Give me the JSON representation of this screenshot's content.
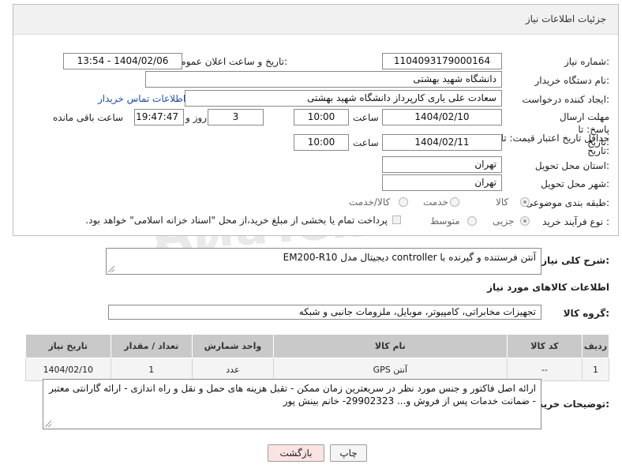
{
  "header": {
    "title": "جزئیات اطلاعات نیاز"
  },
  "watermark": {
    "text": "AriaTender.neT"
  },
  "form": {
    "need_number": {
      "label": "شماره نیاز:",
      "value": "1104093179000164"
    },
    "announce": {
      "label": "تاریخ و ساعت اعلان عمومی:",
      "value": "1404/02/06 - 13:54"
    },
    "buyer": {
      "label": "نام دستگاه خریدار:",
      "value": "دانشگاه شهید بهشتی"
    },
    "creator": {
      "label": "ایجاد کننده درخواست:",
      "value": "سعادت علی یاری کارپرداز دانشگاه شهید بهشتی",
      "contact_link": "اطلاعات تماس خریدار"
    },
    "response_deadline": {
      "label": "مهلت ارسال پاسخ: تا تاریخ:",
      "date": "1404/02/10",
      "time_label": "ساعت",
      "time": "10:00",
      "days": "3",
      "days_label": "روز و",
      "remaining": "19:47:47",
      "remaining_label": "ساعت باقی مانده"
    },
    "price_validity": {
      "label": "حداقل تاریخ اعتبار قیمت: تا تاریخ:",
      "date": "1404/02/11",
      "time_label": "ساعت",
      "time": "10:00"
    },
    "province": {
      "label": "استان محل تحویل:",
      "value": "تهران"
    },
    "city": {
      "label": "شهر محل تحویل:",
      "value": "تهران"
    },
    "category": {
      "label": "طبقه بندی موضوعی:",
      "options": [
        "کالا",
        "خدمت",
        "کالا/خدمت"
      ],
      "selected": "کالا"
    },
    "process": {
      "label": "نوع فرآیند خرید :",
      "options": [
        "جزیی",
        "متوسط"
      ],
      "selected": "جزیی",
      "note": "پرداخت تمام یا بخشی از مبلغ خرید،از محل \"اسناد خزانه اسلامی\" خواهد بود."
    }
  },
  "description": {
    "label": "شرح کلی نیاز:",
    "value": "آنتن فرستنده و گیرنده با controller دیجیتال مدل EM200-R10"
  },
  "goods_section": {
    "title": "اطلاعات کالاهای مورد نیاز"
  },
  "goods_group": {
    "label": "گروه کالا:",
    "value": "تجهیزات مخابراتی، کامپیوتر، موبایل، ملزومات جانبی و شبکه"
  },
  "table": {
    "headers": [
      "ردیف",
      "کد کالا",
      "نام کالا",
      "واحد شمارش",
      "تعداد / مقدار",
      "تاریخ نیاز"
    ],
    "rows": [
      [
        "1",
        "--",
        "آنتن GPS",
        "عدد",
        "1",
        "1404/02/10"
      ]
    ]
  },
  "buyer_notes": {
    "label": "توضیحات خریدار:",
    "value": "ارائه اصل فاکتور و جنس مورد نظر در سریعترین زمان ممکن - تقبل هزینه های حمل و نقل و راه اندازی - ارائه گارانتی معتبر - ضمانت خدمات پس از فروش و... 29902323- خانم بینش پور"
  },
  "buttons": {
    "print": "چاپ",
    "back": "بازگشت"
  },
  "colors": {
    "back_button_bg": "#fbe3e3",
    "link": "#1d4fa6",
    "table_header": "#c9c9c9"
  }
}
